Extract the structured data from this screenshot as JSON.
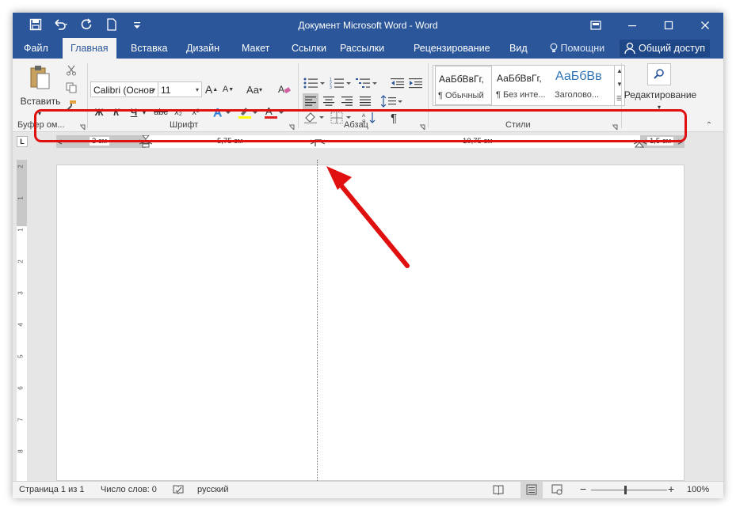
{
  "window": {
    "title": "Документ Microsoft Word - Word"
  },
  "quick_access": [
    "save-icon",
    "undo-icon",
    "redo-icon",
    "new-document-icon",
    "customize-icon"
  ],
  "tabs": [
    {
      "label": "Файл"
    },
    {
      "label": "Главная"
    },
    {
      "label": "Вставка"
    },
    {
      "label": "Дизайн"
    },
    {
      "label": "Макет"
    },
    {
      "label": "Ссылки"
    },
    {
      "label": "Рассылки"
    },
    {
      "label": "Рецензирование"
    },
    {
      "label": "Вид"
    }
  ],
  "tell_me": "Помощни",
  "share": "Общий доступ",
  "ribbon": {
    "clipboard": {
      "paste_label": "Вставить",
      "group_label": "Буфер ом..."
    },
    "font": {
      "font_name": "Calibri (Основ",
      "font_size": "11",
      "group_label": "Шрифт",
      "bold": "Ж",
      "italic": "К",
      "underline": "Ч",
      "strike": "abc",
      "sub": "x₂",
      "sup": "x²",
      "grow": "A",
      "shrink": "A",
      "case": "Aa"
    },
    "paragraph": {
      "group_label": "Абзац",
      "pilcrow": "¶"
    },
    "styles": {
      "group_label": "Стили",
      "items": [
        {
          "sample": "АаБбВвГг,",
          "name": "¶ Обычный"
        },
        {
          "sample": "АаБбВвГг,",
          "name": "¶ Без инте..."
        },
        {
          "sample": "АаБбВв",
          "name": "Заголово..."
        }
      ]
    },
    "editing": {
      "label": "Редактирование"
    }
  },
  "ruler": {
    "tab_selector": "L",
    "dimensions": [
      "3 см",
      "5,75 см",
      "10,75 см",
      "1,5 см"
    ]
  },
  "vruler_labels": [
    "2",
    "1",
    "1",
    "2",
    "3",
    "4",
    "5",
    "6",
    "7",
    "8"
  ],
  "status": {
    "page": "Страница 1 из 1",
    "words": "Число слов: 0",
    "language": "русский",
    "zoom": "100%",
    "zoom_minus": "−",
    "zoom_plus": "+"
  },
  "colors": {
    "accent": "#2b579a",
    "annotation": "#e01010"
  }
}
